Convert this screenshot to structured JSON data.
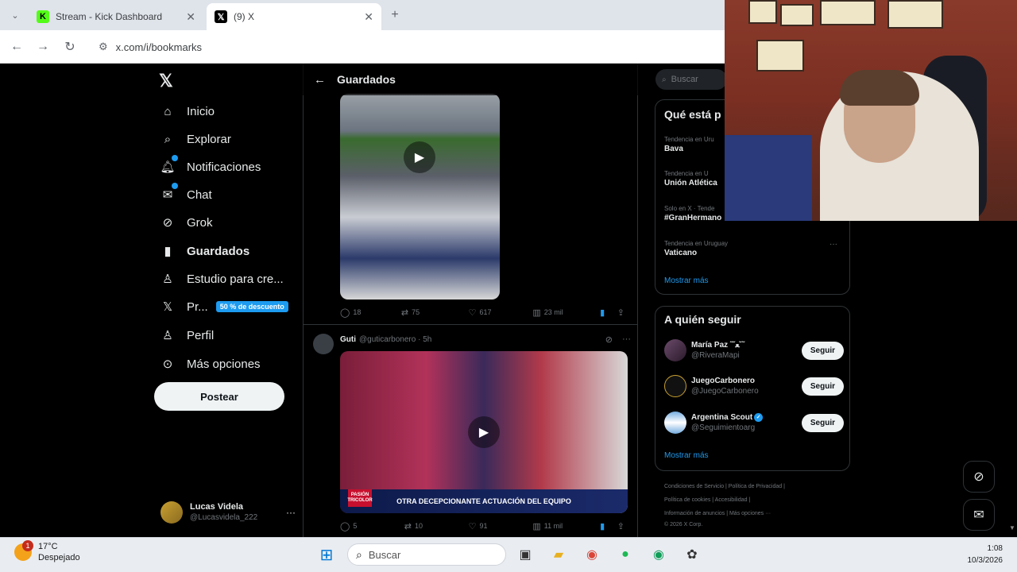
{
  "browser": {
    "tabs": [
      {
        "title": "Stream - Kick Dashboard",
        "icon": "kick-icon",
        "color": "#53fc18"
      },
      {
        "title": "(9) X",
        "icon": "x-icon",
        "color": "#000000"
      }
    ],
    "url": "x.com/i/bookmarks"
  },
  "nav": {
    "items": [
      {
        "label": "Inicio",
        "icon": "home-icon"
      },
      {
        "label": "Explorar",
        "icon": "search-icon"
      },
      {
        "label": "Notificaciones",
        "icon": "bell-icon"
      },
      {
        "label": "Chat",
        "icon": "mail-icon"
      },
      {
        "label": "Grok",
        "icon": "grok-icon"
      },
      {
        "label": "Guardados",
        "icon": "bookmark-icon"
      },
      {
        "label": "Estudio para cre...",
        "icon": "studio-icon"
      },
      {
        "label": "Pr...",
        "icon": "x-premium-icon",
        "badge": "50 % de descuento"
      },
      {
        "label": "Perfil",
        "icon": "person-icon"
      },
      {
        "label": "Más opciones",
        "icon": "more-circle-icon"
      }
    ],
    "post_button": "Postear",
    "account": {
      "name": "Lucas Videla",
      "handle": "@Lucasvidela_222",
      "more": "···"
    }
  },
  "timeline": {
    "title": "Guardados",
    "post1": {
      "replies": "18",
      "reposts": "75",
      "likes": "617",
      "views": "23 mil"
    },
    "post2": {
      "author": "Guti",
      "handle_time": "@guticarbonero · 5h",
      "banner": "OTRA DECEPCIONANTE ACTUACIÓN DEL EQUIPO",
      "badge": "PASIÓN TRICOLOR",
      "replies": "5",
      "reposts": "10",
      "likes": "91",
      "views": "11 mil"
    }
  },
  "right": {
    "search_placeholder": "Buscar",
    "trends_title": "Qué está p",
    "trends": [
      {
        "category": "Tendencia en Uru",
        "name": "Bava"
      },
      {
        "category": "Tendencia en U",
        "name": "Unión Atlética"
      },
      {
        "category": "Solo en X · Tende",
        "name": "#GranHermano"
      },
      {
        "category": "Tendencia en Uruguay",
        "name": "Vaticano"
      }
    ],
    "trends_more_menu": "···",
    "show_more": "Mostrar más",
    "follow_title": "A quién seguir",
    "follow": [
      {
        "name": "María Paz ˜˘ﻌ˘˜",
        "handle": "@RiveraMapi",
        "button": "Seguir"
      },
      {
        "name": "JuegoCarbonero",
        "handle": "@JuegoCarbonero",
        "button": "Seguir"
      },
      {
        "name": "Argentina Scout",
        "handle": "@Seguimientoarg",
        "button": "Seguir",
        "verified": true
      }
    ],
    "follow_more": "Mostrar más",
    "footer": [
      "Condiciones de Servicio  |  Política de Privacidad  |",
      "Política de cookies  |  Accesibilidad  |",
      "Información de anuncios  |  Más opciones ···",
      "© 2026 X Corp."
    ]
  },
  "taskbar": {
    "temp": "17°C",
    "weather": "Despejado",
    "alert_count": "1",
    "search": "Buscar",
    "time": "1:08",
    "date": "10/3/2026"
  },
  "colors": {
    "accent": "#1d9bf0",
    "background": "#000000"
  }
}
